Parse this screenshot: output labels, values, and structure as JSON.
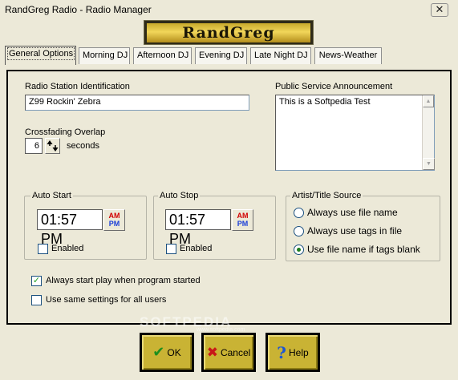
{
  "window": {
    "title": "RandGreg Radio - Radio Manager",
    "close_glyph": "✕"
  },
  "logo": {
    "text": "RandGreg"
  },
  "tabs": [
    {
      "label": "General Options",
      "active": true
    },
    {
      "label": "Morning DJ",
      "active": false
    },
    {
      "label": "Afternoon DJ",
      "active": false
    },
    {
      "label": "Evening DJ",
      "active": false
    },
    {
      "label": "Late Night DJ",
      "active": false
    },
    {
      "label": "News-Weather",
      "active": false
    }
  ],
  "general": {
    "station_id_label": "Radio Station Identification",
    "station_id_value": "Z99 Rockin' Zebra",
    "crossfade_label": "Crossfading Overlap",
    "crossfade_value": "6",
    "crossfade_unit": "seconds",
    "psa_label": "Public Service Announcement",
    "psa_value": "This is a Softpedia Test"
  },
  "auto_start": {
    "title": "Auto Start",
    "time": "01:57 PM",
    "am_label": "AM",
    "pm_label": "PM",
    "enabled_label": "Enabled",
    "enabled": false
  },
  "auto_stop": {
    "title": "Auto Stop",
    "time": "01:57 PM",
    "am_label": "AM",
    "pm_label": "PM",
    "enabled_label": "Enabled",
    "enabled": false
  },
  "artist_source": {
    "title": "Artist/Title Source",
    "options": [
      {
        "label": "Always use file name",
        "selected": false
      },
      {
        "label": "Always use tags in file",
        "selected": false
      },
      {
        "label": "Use file name if tags blank",
        "selected": true
      }
    ]
  },
  "options": {
    "always_start_label": "Always start play when program started",
    "always_start_checked": true,
    "same_settings_label": "Use same settings for all users",
    "same_settings_checked": false
  },
  "buttons": {
    "ok_label": "OK",
    "cancel_label": "Cancel",
    "help_label": "Help"
  },
  "watermark": {
    "text": "SOFTPEDIA",
    "url": "www.softpedia.com"
  },
  "colors": {
    "window_bg": "#ece9d8",
    "button_gold": "#c9b334",
    "ok_green": "#1e8f1e",
    "cancel_red": "#c81818",
    "help_blue": "#1d56d3",
    "am_red": "#d20000",
    "pm_blue": "#1b3fd8"
  }
}
